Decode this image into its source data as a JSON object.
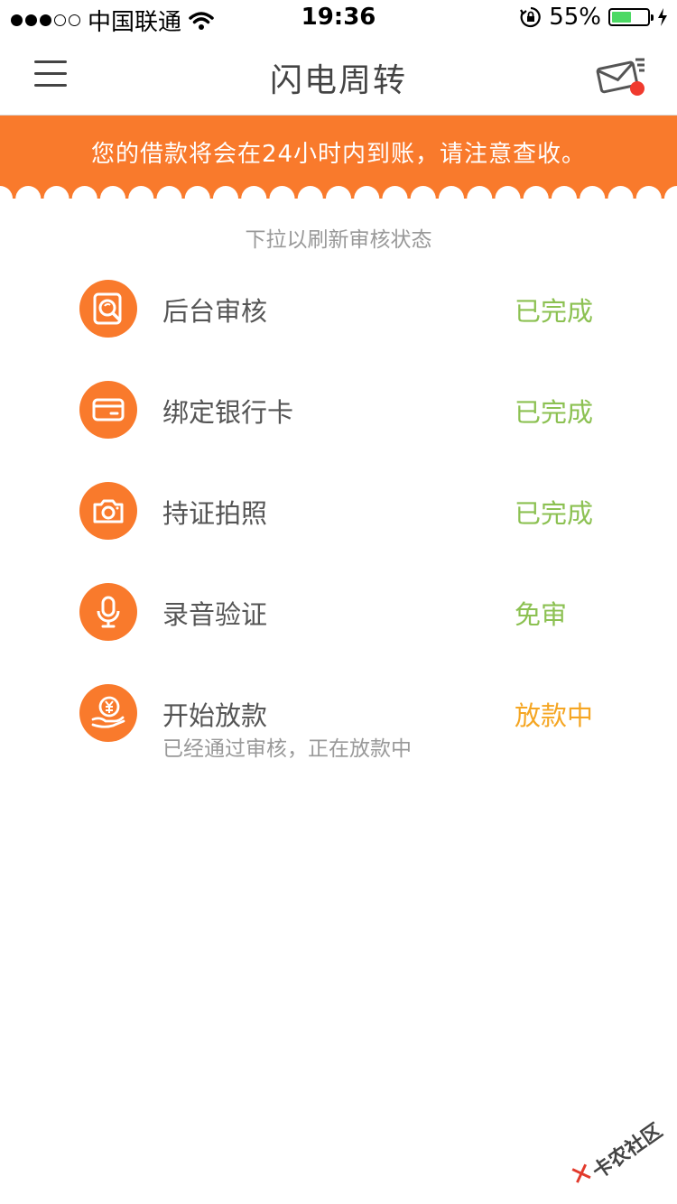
{
  "status_bar": {
    "carrier": "中国联通",
    "time": "19:36",
    "battery_percent": "55%",
    "battery_level": 0.55
  },
  "nav": {
    "title": "闪电周转"
  },
  "banner": {
    "text": "您的借款将会在24小时内到账，请注意查收。"
  },
  "pull_hint": "下拉以刷新审核状态",
  "steps": [
    {
      "label": "后台审核",
      "status": "已完成",
      "icon": "search-review-icon"
    },
    {
      "label": "绑定银行卡",
      "status": "已完成",
      "icon": "bank-card-icon"
    },
    {
      "label": "持证拍照",
      "status": "已完成",
      "icon": "camera-icon"
    },
    {
      "label": "录音验证",
      "status": "免审",
      "icon": "microphone-icon"
    },
    {
      "label": "开始放款",
      "status": "放款中",
      "subtitle": "已经通过审核，正在放款中",
      "icon": "yuan-hand-icon"
    }
  ],
  "watermark": {
    "text": "卡农社区",
    "mark": "✕"
  },
  "colors": {
    "accent": "#f97a2c",
    "done": "#8cc152",
    "in_progress": "#f5a623"
  }
}
